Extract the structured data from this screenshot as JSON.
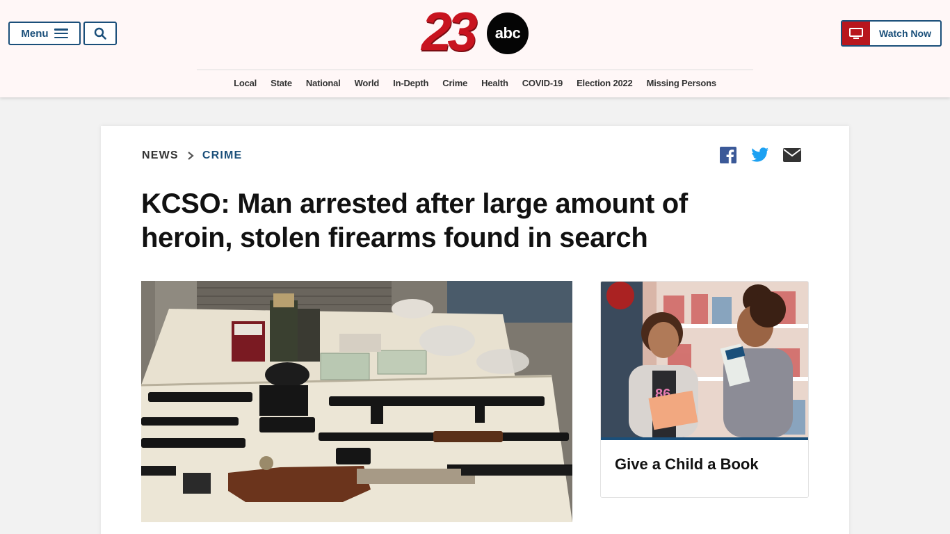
{
  "header": {
    "menu_label": "Menu",
    "logo": {
      "number": "23",
      "network": "abc",
      "color": "#c8141f"
    },
    "watch_label": "Watch Now",
    "accent": "#1a4f7a",
    "watch_accent": "#b8161d"
  },
  "nav": {
    "items": [
      {
        "label": "Local"
      },
      {
        "label": "State"
      },
      {
        "label": "National"
      },
      {
        "label": "World"
      },
      {
        "label": "In-Depth"
      },
      {
        "label": "Crime"
      },
      {
        "label": "Health"
      },
      {
        "label": "COVID-19"
      },
      {
        "label": "Election 2022"
      },
      {
        "label": "Missing Persons"
      }
    ]
  },
  "article": {
    "breadcrumb": {
      "section": "NEWS",
      "subsection": "CRIME"
    },
    "share_icons": [
      "facebook-icon",
      "twitter-icon",
      "email-icon"
    ],
    "headline": "KCSO: Man arrested after large amount of heroin, stolen firearms found in search"
  },
  "promo": {
    "title": "Give a Child a Book"
  },
  "icons": {
    "menu": "hamburger-icon",
    "search": "search-icon",
    "watch": "tv-icon"
  }
}
